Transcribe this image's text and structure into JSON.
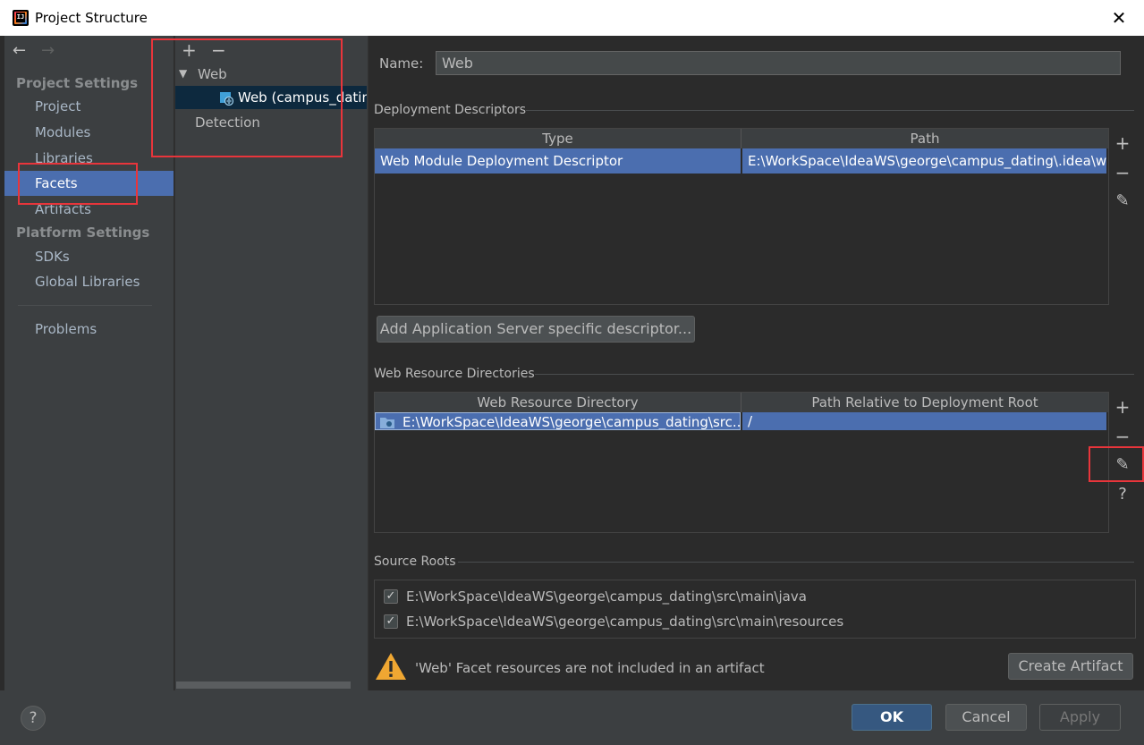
{
  "window": {
    "title": "Project Structure",
    "close_glyph": "✕",
    "logo_text": "IJ"
  },
  "nav": {
    "back": "←",
    "forward": "→",
    "project_settings": "Project Settings",
    "items_project": [
      "Project",
      "Modules",
      "Libraries",
      "Facets",
      "Artifacts"
    ],
    "platform_settings": "Platform Settings",
    "items_platform": [
      "SDKs",
      "Global Libraries"
    ],
    "problems": "Problems",
    "selected": "Facets"
  },
  "tree": {
    "add": "+",
    "remove": "−",
    "root": "Web",
    "child": "Web (campus_dating)",
    "detection": "Detection"
  },
  "details": {
    "name_label": "Name:",
    "name_value": "Web",
    "deploy_title": "Deployment Descriptors",
    "deploy_headers": [
      "Type",
      "Path"
    ],
    "deploy_row": [
      "Web Module Deployment Descriptor",
      "E:\\WorkSpace\\IdeaWS\\george\\campus_dating\\.idea\\web.xml"
    ],
    "add_descriptor_btn": "Add Application Server specific descriptor...",
    "resource_title": "Web Resource Directories",
    "resource_headers": [
      "Web Resource Directory",
      "Path Relative to Deployment Root"
    ],
    "resource_row": [
      "E:\\WorkSpace\\IdeaWS\\george\\campus_dating\\src...",
      "/"
    ],
    "source_title": "Source Roots",
    "source_roots": [
      "E:\\WorkSpace\\IdeaWS\\george\\campus_dating\\src\\main\\java",
      "E:\\WorkSpace\\IdeaWS\\george\\campus_dating\\src\\main\\resources"
    ],
    "warning": "'Web' Facet resources are not included in an artifact",
    "create_artifact_btn": "Create Artifact"
  },
  "side_buttons": {
    "add": "+",
    "remove": "−",
    "edit": "✎",
    "help": "?"
  },
  "footer": {
    "help": "?",
    "ok": "OK",
    "cancel": "Cancel",
    "apply": "Apply"
  },
  "colors": {
    "selection": "#4b6eaf",
    "highlight": "#e8353b",
    "background": "#2b2b2b",
    "panel": "#3c3f41"
  }
}
